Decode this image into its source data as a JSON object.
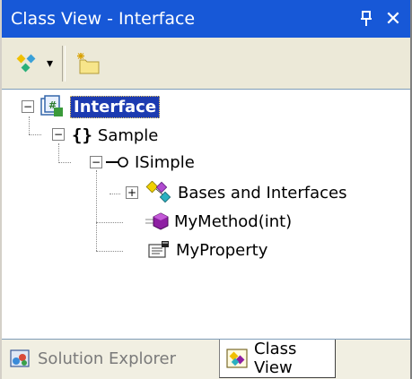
{
  "window": {
    "title": "Class View - Interface",
    "pin_glyph": "↕",
    "close_glyph": "✕"
  },
  "toolbar": {
    "sort_icon": "sort-by-icon",
    "dropdown_glyph": "▾",
    "new_folder_icon": "new-folder-icon"
  },
  "tree": {
    "root": {
      "label": "Interface",
      "icon": "project-icon",
      "expander": "−"
    },
    "namespace": {
      "label": "Sample",
      "icon": "namespace-braces-icon",
      "glyph": "{}",
      "expander": "−"
    },
    "interface": {
      "label": "ISimple",
      "icon": "interface-icon",
      "expander": "−"
    },
    "bases": {
      "label": "Bases and Interfaces",
      "icon": "bases-icon",
      "expander": "+"
    },
    "method": {
      "label": "MyMethod(int)",
      "icon": "method-icon"
    },
    "property": {
      "label": "MyProperty",
      "icon": "property-icon"
    }
  },
  "tabs": [
    {
      "label": "Solution Explorer",
      "icon": "solution-explorer-icon",
      "active": false
    },
    {
      "label": "Class View",
      "icon": "class-view-icon",
      "active": true
    }
  ],
  "colors": {
    "titlebar": "#1758d7",
    "selection": "#1c3bb1",
    "method_purple": "#8e1fa3"
  }
}
